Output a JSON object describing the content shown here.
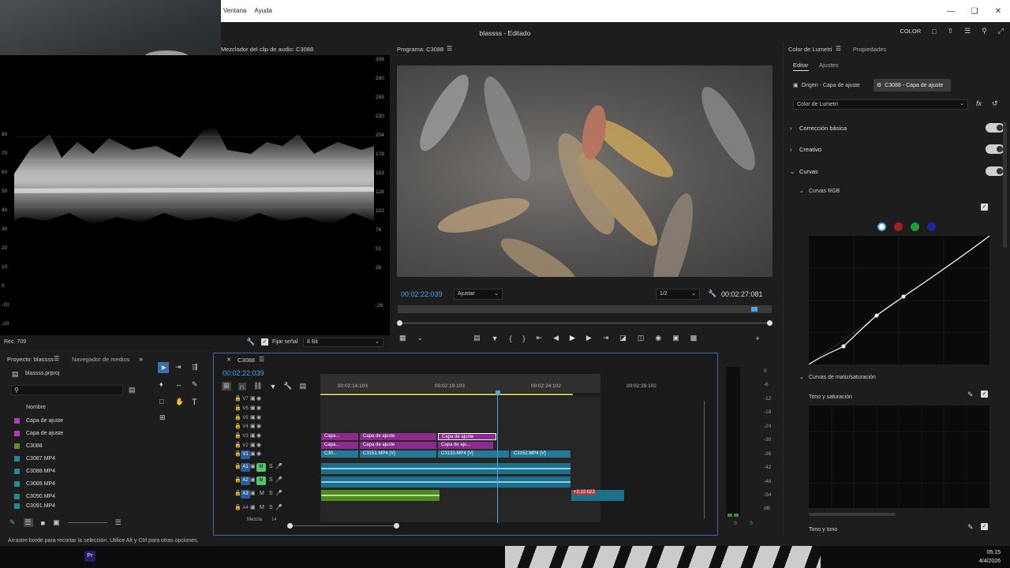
{
  "menu": {
    "items": [
      "Ventana",
      "Ayuda"
    ]
  },
  "window": {
    "title": "blassss - Editado",
    "workspace": "COLOR"
  },
  "audio_meter": {
    "title": "Mezclador del clip de audio: C3088"
  },
  "scope": {
    "label": "Rec. 709",
    "left_ticks": [
      "80",
      "70",
      "60",
      "50",
      "40",
      "30",
      "20",
      "10",
      "0",
      "-10",
      "-20"
    ],
    "right_ticks": [
      "306",
      "280",
      "255",
      "230",
      "204",
      "178",
      "153",
      "128",
      "102",
      "76",
      "51",
      "26",
      "-26"
    ],
    "fix_signal": "Fijar señal",
    "bit_depth": "8 Bit"
  },
  "program": {
    "title": "Programa: C3088",
    "timecode_in": "00:02:22:039",
    "fit": "Ajustar",
    "quality": "1/2",
    "timecode_out": "00:02:27:081"
  },
  "project": {
    "tabs": [
      "Proyecto: blassss",
      "Navegador de medios"
    ],
    "file": "blassss.prproj",
    "column": "Nombre",
    "items": [
      {
        "name": "Capa de ajuste",
        "color": "#b43ab8"
      },
      {
        "name": "Capa de ajuste",
        "color": "#b43ab8"
      },
      {
        "name": "C3088",
        "color": "#6c8a22"
      },
      {
        "name": "C3087.MP4",
        "color": "#1f8a9a"
      },
      {
        "name": "C3088.MP4",
        "color": "#1f8a9a"
      },
      {
        "name": "C3089.MP4",
        "color": "#1f8a9a"
      },
      {
        "name": "C3090.MP4",
        "color": "#1f8a9a"
      },
      {
        "name": "C3091.MP4",
        "color": "#1f8a9a"
      }
    ]
  },
  "timeline": {
    "tab": "C3088",
    "timecode": "00:02:22:039",
    "ruler": [
      "00:02:14:103",
      "00:02:19:103",
      "00:02:24:102",
      "00:02:29:102"
    ],
    "tracks_video": [
      "V7",
      "V6",
      "V5",
      "V4",
      "V3",
      "V2",
      "V1"
    ],
    "tracks_audio": [
      "A1",
      "A2",
      "A3",
      "A4"
    ],
    "mix_label": "Mezcla",
    "mix_value": "14",
    "clips": {
      "v3a": "Capa...",
      "v3b": "Capa de ajuste",
      "v3c": "Capa de ajuste",
      "v2a": "Capa...",
      "v2b": "Capa de ajuste",
      "v2c": "Capa de aju...",
      "v1a": "C30...",
      "v1b": "C3151.MP4 [V]",
      "v1c": "C3133.MP4 [V]",
      "v1d": "C3152.MP4 [V]",
      "a3tag": "+2:22:022"
    },
    "meter_ticks": [
      "0",
      "-6",
      "-12",
      "-18",
      "-24",
      "-30",
      "-36",
      "-42",
      "-48",
      "-54",
      "dB"
    ]
  },
  "lumetri": {
    "tabs": [
      "Color de Lumetri",
      "Propiedades"
    ],
    "subtabs": [
      "Editar",
      "Ajustes"
    ],
    "source": "Origen - Capa de ajuste",
    "target": "C3088 - Capa de ajuste",
    "effect": "Color de Lumetri",
    "sections": [
      "Corrección básica",
      "Creativo",
      "Curvas"
    ],
    "curves_rgb": "Curvas RGB",
    "hue_sat_curves": "Curvas de matiz/saturación",
    "hue_sat": "Tono y saturación",
    "hue_hue": "Tono y tono"
  },
  "status": {
    "text": "Arrastre borde para recortar la selección. Utilice Alt y Ctrl para otras opciones."
  },
  "taskbar": {
    "time": "05:15",
    "date": "4/4/2026",
    "app": "Pr"
  }
}
